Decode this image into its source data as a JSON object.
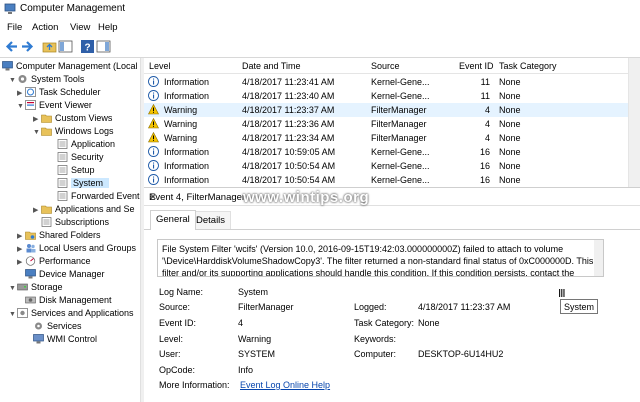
{
  "window": {
    "title": "Computer Management"
  },
  "menu": {
    "items": [
      "File",
      "Action",
      "View",
      "Help"
    ]
  },
  "tree": {
    "items": [
      {
        "label": "Computer Management (Local",
        "icon": "computer-management-icon"
      },
      {
        "label": "System Tools",
        "icon": "system-tools-icon"
      },
      {
        "label": "Task Scheduler",
        "icon": "task-scheduler-icon"
      },
      {
        "label": "Event Viewer",
        "icon": "event-viewer-icon"
      },
      {
        "label": "Custom Views",
        "icon": "folder-icon"
      },
      {
        "label": "Windows Logs",
        "icon": "folder-icon"
      },
      {
        "label": "Application",
        "icon": "log-icon"
      },
      {
        "label": "Security",
        "icon": "log-icon"
      },
      {
        "label": "Setup",
        "icon": "log-icon"
      },
      {
        "label": "System",
        "icon": "log-icon"
      },
      {
        "label": "Forwarded Event",
        "icon": "log-icon"
      },
      {
        "label": "Applications and Se",
        "icon": "folder-icon"
      },
      {
        "label": "Subscriptions",
        "icon": "log-icon"
      },
      {
        "label": "Shared Folders",
        "icon": "shared-folders-icon"
      },
      {
        "label": "Local Users and Groups",
        "icon": "users-icon"
      },
      {
        "label": "Performance",
        "icon": "performance-icon"
      },
      {
        "label": "Device Manager",
        "icon": "device-manager-icon"
      },
      {
        "label": "Storage",
        "icon": "storage-icon"
      },
      {
        "label": "Disk Management",
        "icon": "disk-icon"
      },
      {
        "label": "Services and Applications",
        "icon": "services-icon"
      },
      {
        "label": "Services",
        "icon": "gear-icon"
      },
      {
        "label": "WMI Control",
        "icon": "wmi-icon"
      }
    ]
  },
  "events": {
    "columns": [
      "Level",
      "Date and Time",
      "Source",
      "Event ID",
      "Task Category"
    ],
    "rows": [
      {
        "level": "Information",
        "date": "4/18/2017 11:23:41 AM",
        "source": "Kernel-Gene...",
        "id": "11",
        "category": "None"
      },
      {
        "level": "Information",
        "date": "4/18/2017 11:23:40 AM",
        "source": "Kernel-Gene...",
        "id": "11",
        "category": "None"
      },
      {
        "level": "Warning",
        "date": "4/18/2017 11:23:37 AM",
        "source": "FilterManager",
        "id": "4",
        "category": "None"
      },
      {
        "level": "Warning",
        "date": "4/18/2017 11:23:36 AM",
        "source": "FilterManager",
        "id": "4",
        "category": "None"
      },
      {
        "level": "Warning",
        "date": "4/18/2017 11:23:34 AM",
        "source": "FilterManager",
        "id": "4",
        "category": "None"
      },
      {
        "level": "Information",
        "date": "4/18/2017 10:59:05 AM",
        "source": "Kernel-Gene...",
        "id": "16",
        "category": "None"
      },
      {
        "level": "Information",
        "date": "4/18/2017 10:50:54 AM",
        "source": "Kernel-Gene...",
        "id": "16",
        "category": "None"
      },
      {
        "level": "Information",
        "date": "4/18/2017 10:50:54 AM",
        "source": "Kernel-Gene...",
        "id": "16",
        "category": "None"
      }
    ]
  },
  "detail": {
    "title": "Event 4, FilterManager",
    "tabs": [
      "General",
      "Details"
    ],
    "message": "File System Filter 'wcifs' (Version 10.0, 2016-09-15T19:42:03.000000000Z) failed to attach to volume '\\Device\\HarddiskVolumeShadowCopy3'.  The filter returned a non-standard final status of 0xC000000D.  This filter and/or its supporting applications should handle this condition.  If this condition persists, contact the vendor.",
    "fields": {
      "log_name_label": "Log Name:",
      "log_name": "System",
      "source_label": "Source:",
      "source": "FilterManager",
      "logged_label": "Logged:",
      "logged": "4/18/2017 11:23:37 AM",
      "event_id_label": "Event ID:",
      "event_id": "4",
      "task_category_label": "Task Category:",
      "task_category": "None",
      "level_label": "Level:",
      "level": "Warning",
      "keywords_label": "Keywords:",
      "keywords": "",
      "user_label": "User:",
      "user": "SYSTEM",
      "computer_label": "Computer:",
      "computer": "DESKTOP-6U14HU2",
      "opcode_label": "OpCode:",
      "opcode": "Info",
      "more_info_label": "More Information:",
      "more_info_link": "Event Log Online Help"
    }
  },
  "tooltip": "System",
  "watermark": "www.wintips.org",
  "colors": {
    "selection": "#cce8ff",
    "info_blue": "#1e5aa8",
    "warning_yellow": "#f5c400",
    "link": "#0645ad"
  }
}
